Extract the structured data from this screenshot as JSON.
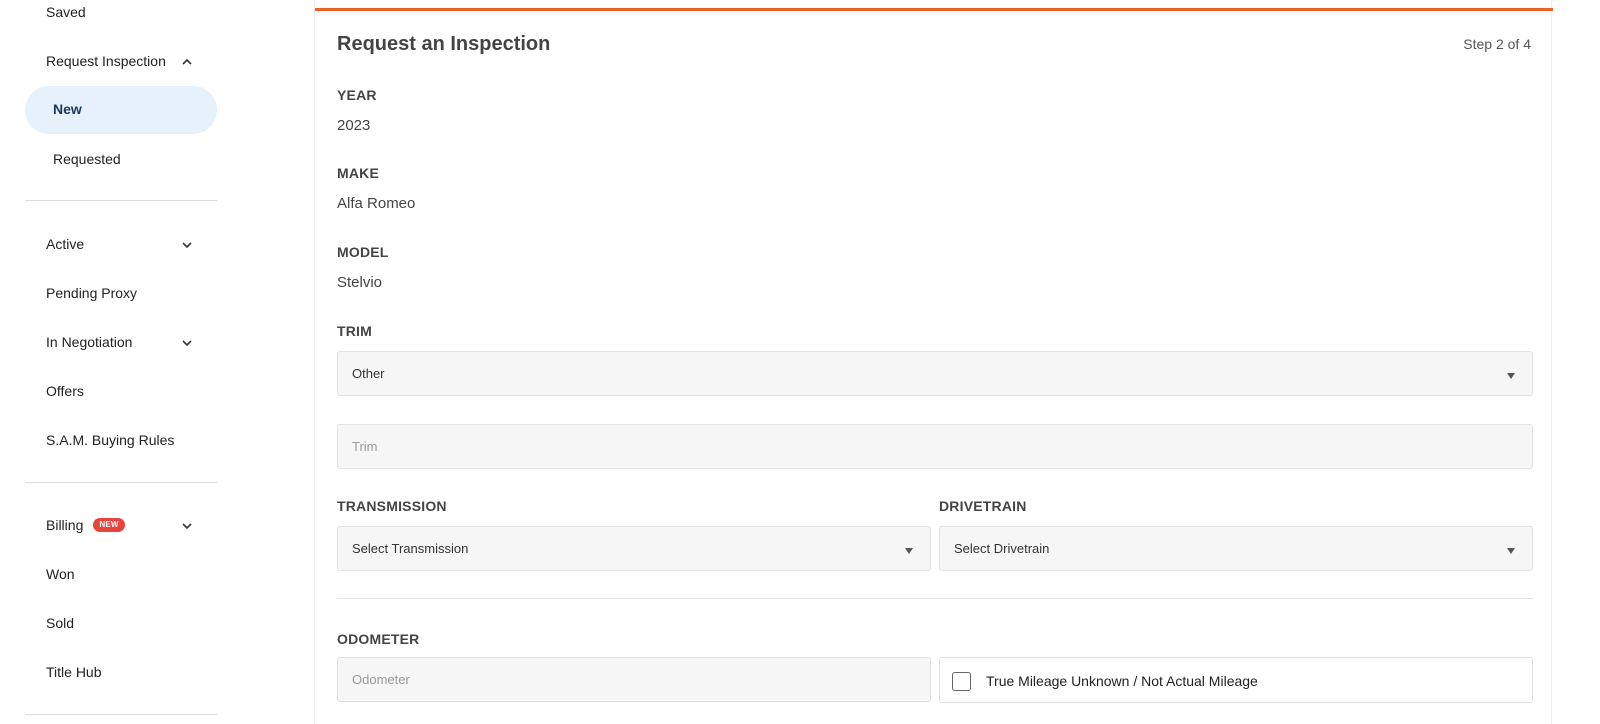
{
  "colors": {
    "accent": "#e8622a",
    "active_pill": "#e6f1fb",
    "badge": "#e8433d"
  },
  "sidebar": {
    "saved": "Saved",
    "request_inspection": "Request Inspection",
    "new": "New",
    "requested": "Requested",
    "active": "Active",
    "pending_proxy": "Pending Proxy",
    "in_negotiation": "In Negotiation",
    "offers": "Offers",
    "sam_rules": "S.A.M. Buying Rules",
    "billing": "Billing",
    "billing_badge": "NEW",
    "won": "Won",
    "sold": "Sold",
    "title_hub": "Title Hub"
  },
  "form": {
    "title": "Request an Inspection",
    "step": "Step 2 of 4",
    "year_label": "YEAR",
    "year_value": "2023",
    "make_label": "MAKE",
    "make_value": "Alfa Romeo",
    "model_label": "MODEL",
    "model_value": "Stelvio",
    "trim_label": "TRIM",
    "trim_selected": "Other",
    "trim_placeholder": "Trim",
    "transmission_label": "TRANSMISSION",
    "transmission_selected": "Select Transmission",
    "drivetrain_label": "DRIVETRAIN",
    "drivetrain_selected": "Select Drivetrain",
    "odometer_label": "ODOMETER",
    "odometer_placeholder": "Odometer",
    "mileage_checkbox_label": "True Mileage Unknown / Not Actual Mileage"
  },
  "icons": {
    "chevron_up": "chevron-up-icon",
    "chevron_down": "chevron-down-icon",
    "dropdown_caret": "caret-down-icon"
  }
}
